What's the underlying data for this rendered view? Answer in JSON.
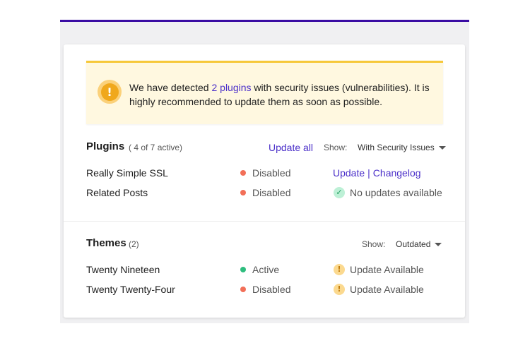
{
  "notice": {
    "text_before": "We have detected ",
    "link_text": "2 plugins",
    "text_after": " with security issues (vulnerabilities). It is highly recommended to update them as soon as possible.",
    "icon": "exclamation-icon",
    "accent_color": "#f6c83a"
  },
  "plugins": {
    "title": "Plugins",
    "subtitle": "( 4 of 7 active)",
    "update_all_label": "Update all",
    "show_label": "Show:",
    "filter_value": "With Security Issues",
    "rows": [
      {
        "name": "Really Simple SSL",
        "status": "Disabled",
        "status_color": "#f26f58",
        "update_label": "Update",
        "separator": "|",
        "changelog_label": "Changelog"
      },
      {
        "name": "Related Posts",
        "status": "Disabled",
        "status_color": "#f26f58",
        "action_text": "No updates available",
        "action_icon": "check-icon"
      }
    ]
  },
  "themes": {
    "title": "Themes",
    "subtitle": "(2)",
    "show_label": "Show:",
    "filter_value": "Outdated",
    "rows": [
      {
        "name": "Twenty Nineteen",
        "status": "Active",
        "status_color": "#2ebd7e",
        "action_text": "Update Available",
        "action_icon": "warning-icon"
      },
      {
        "name": "Twenty Twenty-Four",
        "status": "Disabled",
        "status_color": "#f26f58",
        "action_text": "Update Available",
        "action_icon": "warning-icon"
      }
    ]
  },
  "colors": {
    "brand_purple": "#3a0ca3",
    "link": "#4b30c9"
  }
}
